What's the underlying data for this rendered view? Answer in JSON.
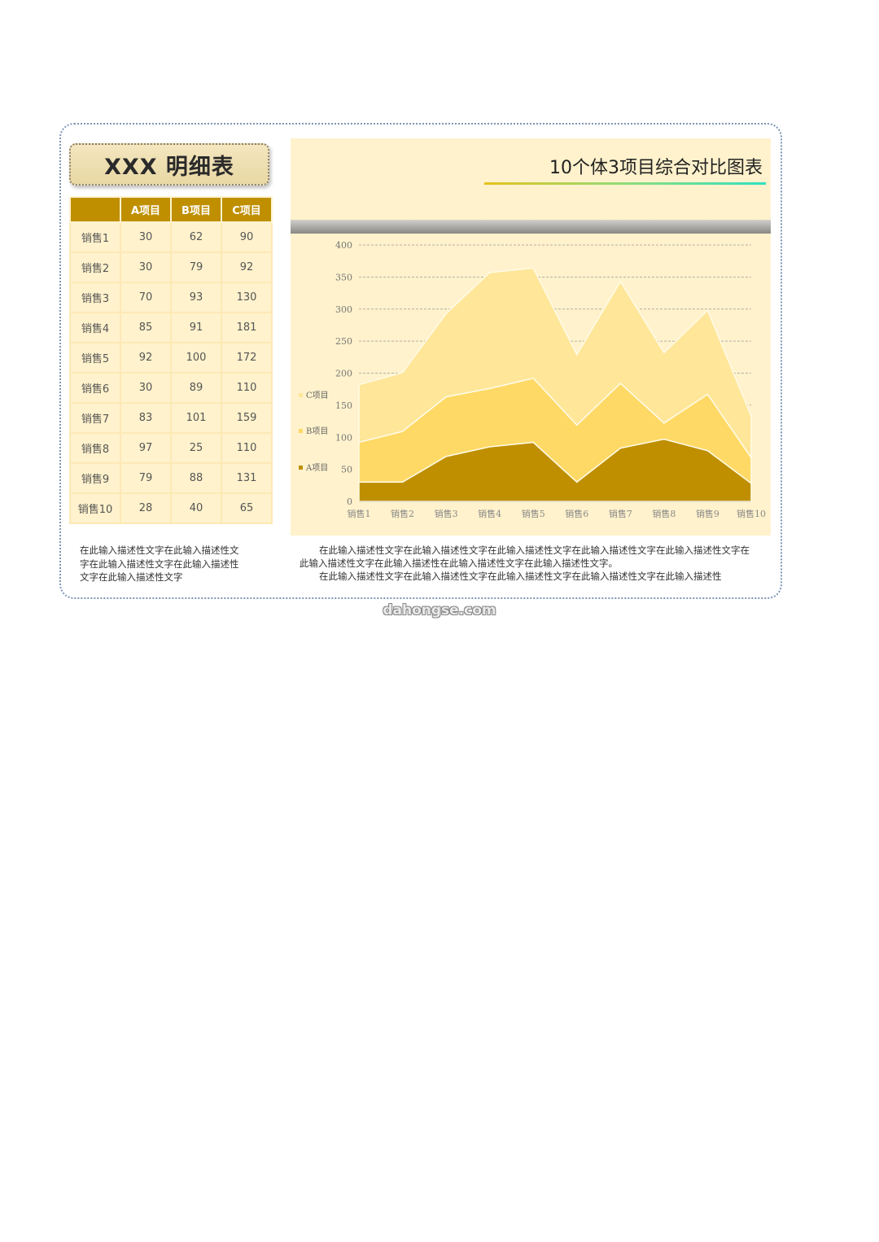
{
  "detail": {
    "title": "XXX 明细表",
    "headers": [
      "",
      "A项目",
      "B项目",
      "C项目"
    ],
    "rows": [
      [
        "销售1",
        "30",
        "62",
        "90"
      ],
      [
        "销售2",
        "30",
        "79",
        "92"
      ],
      [
        "销售3",
        "70",
        "93",
        "130"
      ],
      [
        "销售4",
        "85",
        "91",
        "181"
      ],
      [
        "销售5",
        "92",
        "100",
        "172"
      ],
      [
        "销售6",
        "30",
        "89",
        "110"
      ],
      [
        "销售7",
        "83",
        "101",
        "159"
      ],
      [
        "销售8",
        "97",
        "25",
        "110"
      ],
      [
        "销售9",
        "79",
        "88",
        "131"
      ],
      [
        "销售10",
        "28",
        "40",
        "65"
      ]
    ],
    "description": "在此输入描述性文字在此输入描述性文字在此输入描述性文字在此输入描述性文字在此输入描述性文字"
  },
  "chart": {
    "title": "10个体3项目综合对比图表",
    "description": [
      "在此输入描述性文字在此输入描述性文字在此输入描述性文字在此输入描述性文字在此输入描述性文字在此输入描述性文字在此输入描述性在此输入描述性文字在此输入描述性文字。",
      "在此输入描述性文字在此输入描述性文字在此输入描述性文字在此输入描述性文字在此输入描述性"
    ]
  },
  "chart_data": {
    "type": "area",
    "stacked": true,
    "categories": [
      "销售1",
      "销售2",
      "销售3",
      "销售4",
      "销售5",
      "销售6",
      "销售7",
      "销售8",
      "销售9",
      "销售10"
    ],
    "series": [
      {
        "name": "A项目",
        "values": [
          30,
          30,
          70,
          85,
          92,
          30,
          83,
          97,
          79,
          28
        ],
        "color": "#bf8f00"
      },
      {
        "name": "B项目",
        "values": [
          62,
          79,
          93,
          91,
          100,
          89,
          101,
          25,
          88,
          40
        ],
        "color": "#ffd966"
      },
      {
        "name": "C项目",
        "values": [
          90,
          92,
          130,
          181,
          172,
          110,
          159,
          110,
          131,
          65
        ],
        "color": "#ffe699"
      }
    ],
    "yticks": [
      0,
      50,
      100,
      150,
      200,
      250,
      300,
      350,
      400
    ],
    "ylim": [
      0,
      400
    ],
    "grid": true,
    "legend_position": "left"
  },
  "watermark": "dahongse.com"
}
